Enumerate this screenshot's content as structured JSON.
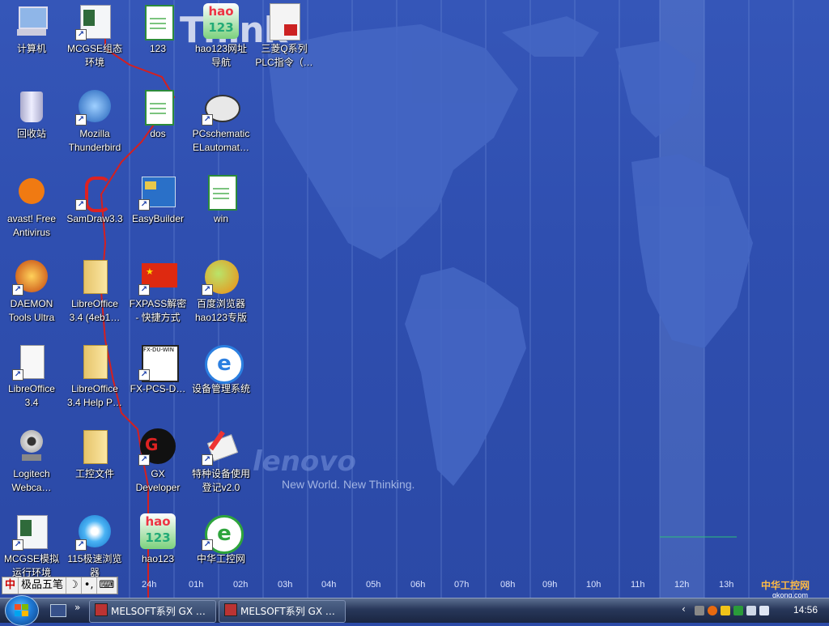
{
  "desktop": {
    "watermark_top": "Think",
    "brand": "lenovo",
    "tagline": "New World. New Thinking.",
    "timezones": [
      "24h",
      "01h",
      "02h",
      "03h",
      "04h",
      "05h",
      "06h",
      "07h",
      "08h",
      "09h",
      "10h",
      "11h",
      "12h",
      "13h"
    ],
    "icons": [
      {
        "id": "computer",
        "label": "计算机",
        "glyph": "computer-icon",
        "shortcut": false
      },
      {
        "id": "mcgse",
        "label": "MCGSE组态\n环境",
        "glyph": "window-app-icon",
        "shortcut": true
      },
      {
        "id": "f123",
        "label": "123",
        "glyph": "spreadsheet-icon",
        "shortcut": false
      },
      {
        "id": "hao123nav",
        "label": "hao123网址\n导航",
        "glyph": "hao123-icon",
        "shortcut": false
      },
      {
        "id": "plc",
        "label": "三菱Q系列\nPLC指令（…",
        "glyph": "pdf-icon",
        "shortcut": false
      },
      {
        "id": "recycle",
        "label": "回收站",
        "glyph": "recycle-bin-icon",
        "shortcut": false
      },
      {
        "id": "thunderbird",
        "label": "Mozilla\nThunderbird",
        "glyph": "thunderbird-icon",
        "shortcut": true
      },
      {
        "id": "dos",
        "label": "dos",
        "glyph": "spreadsheet-icon",
        "shortcut": false
      },
      {
        "id": "pcschematic",
        "label": "PCschematic\nELautomat…",
        "glyph": "pcschematic-icon",
        "shortcut": true
      },
      {
        "id": "avast",
        "label": "avast! Free\nAntivirus",
        "glyph": "avast-icon",
        "shortcut": false
      },
      {
        "id": "samdraw",
        "label": "SamDraw3.3",
        "glyph": "samdraw-icon",
        "shortcut": true
      },
      {
        "id": "easybuilder",
        "label": "EasyBuilder",
        "glyph": "easybuilder-icon",
        "shortcut": true
      },
      {
        "id": "win",
        "label": "win",
        "glyph": "spreadsheet-icon",
        "shortcut": false
      },
      {
        "id": "daemon",
        "label": "DAEMON\nTools Ultra",
        "glyph": "daemon-icon",
        "shortcut": true
      },
      {
        "id": "libre1",
        "label": "LibreOffice\n3.4 (4eb1…",
        "glyph": "folder-icon",
        "shortcut": false
      },
      {
        "id": "fxpass",
        "label": "FXPASS解密\n- 快捷方式",
        "glyph": "china-flag-icon",
        "shortcut": true
      },
      {
        "id": "baidu",
        "label": "百度浏览器\nhao123专版",
        "glyph": "baidu-browser-icon",
        "shortcut": true
      },
      {
        "id": "libre2",
        "label": "LibreOffice\n3.4",
        "glyph": "document-icon",
        "shortcut": true
      },
      {
        "id": "librehelp",
        "label": "LibreOffice\n3.4 Help P…",
        "glyph": "folder-icon",
        "shortcut": false
      },
      {
        "id": "fxpcs",
        "label": "FX-PCS-D…",
        "glyph": "fx-pcs-icon",
        "shortcut": true
      },
      {
        "id": "devmgr",
        "label": "设备管理系统",
        "glyph": "ie-icon",
        "shortcut": false
      },
      {
        "id": "logitech",
        "label": "Logitech\nWebca…",
        "glyph": "webcam-icon",
        "shortcut": false
      },
      {
        "id": "gongkong",
        "label": "工控文件",
        "glyph": "folder-icon",
        "shortcut": false
      },
      {
        "id": "gxdev",
        "label": "GX\nDeveloper",
        "glyph": "gx-developer-icon",
        "shortcut": true
      },
      {
        "id": "special",
        "label": "特种设备使用\n登记v2.0",
        "glyph": "pen-icon",
        "shortcut": true
      },
      {
        "id": "mcgsesim",
        "label": "MCGSE模拟\n运行环境",
        "glyph": "window-app-icon",
        "shortcut": true
      },
      {
        "id": "b115",
        "label": "115极速浏览\n器",
        "glyph": "browser-115-icon",
        "shortcut": true
      },
      {
        "id": "hao123",
        "label": "hao123",
        "glyph": "hao123-icon",
        "shortcut": false
      },
      {
        "id": "zhonghua",
        "label": "中华工控网",
        "glyph": "ie-green-icon",
        "shortcut": true
      }
    ]
  },
  "ime": {
    "name": "极品五笔",
    "mode": "☽",
    "punct": "•,",
    "kbd": "⌨"
  },
  "taskbar": {
    "tasks": [
      "MELSOFT系列 GX …",
      "MELSOFT系列 GX …"
    ],
    "clock": "14:56"
  },
  "watermark_site": {
    "text": "中华工控网",
    "url": "gkong.com"
  },
  "colors": {
    "desktop": "#2f4fb0",
    "taskbar": "#1a2642",
    "accent_red": "#d42020"
  }
}
